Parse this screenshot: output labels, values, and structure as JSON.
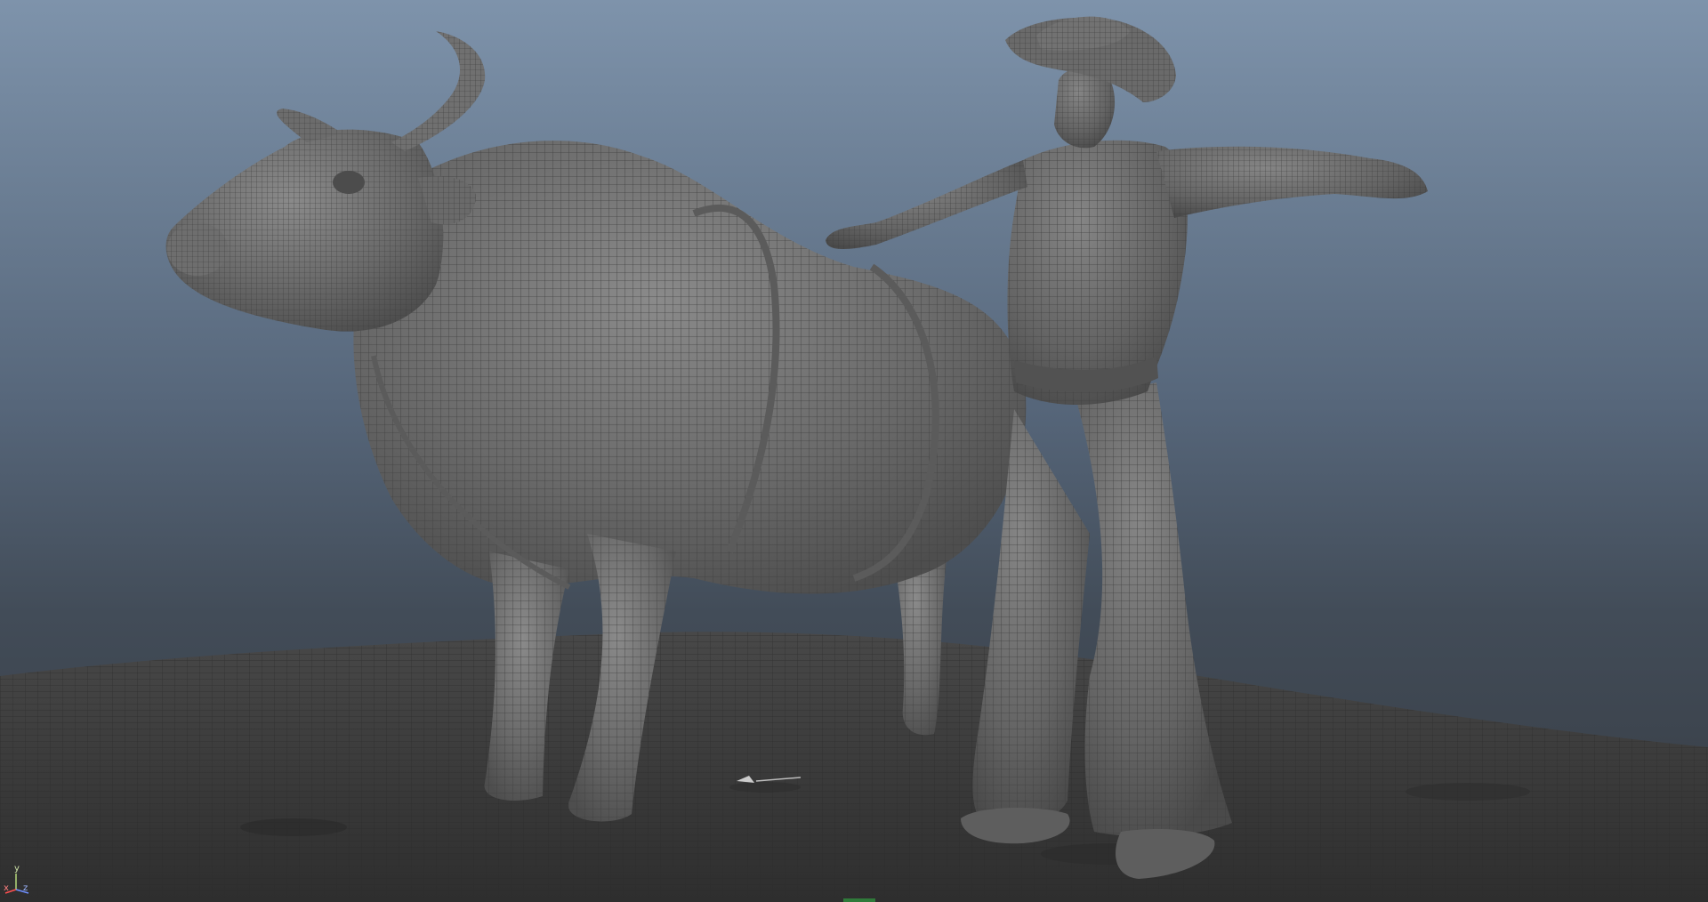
{
  "viewport": {
    "background_top": "#7e93ab",
    "background_bottom": "#363b42",
    "mesh_color": "#6a6a6a",
    "wire_color": "#4a4a4a",
    "ground_color": "#3a3a3a"
  },
  "gizmo": {
    "x_label": "x",
    "y_label": "y",
    "z_label": "z",
    "x_color": "#ff5050",
    "y_color": "#b5d97a",
    "z_color": "#6f8fff"
  }
}
